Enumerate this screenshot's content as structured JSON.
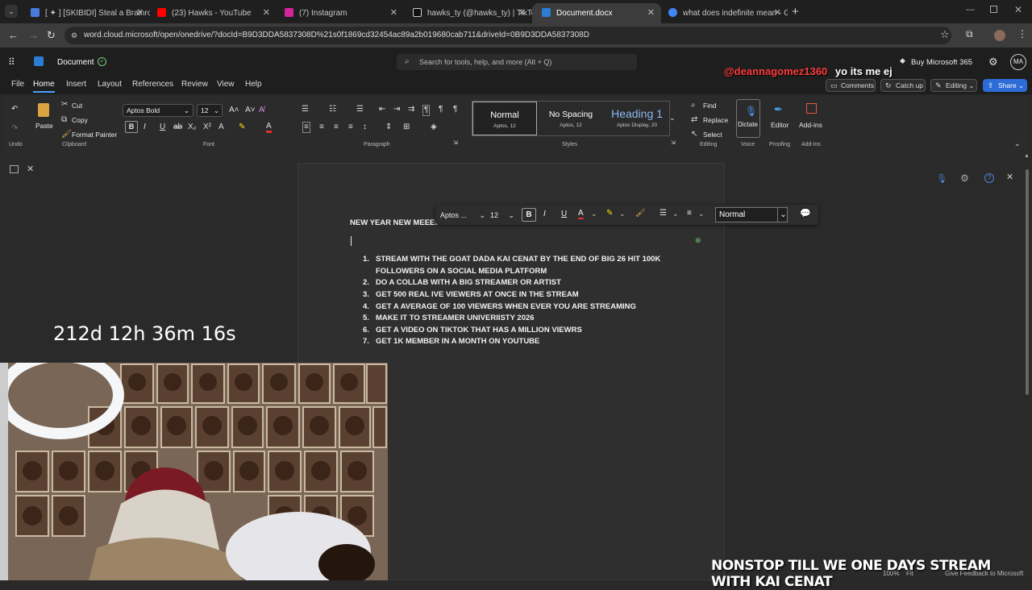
{
  "tabs": [
    {
      "title": "[ ✦ ] [SKIBIDI] Steal a Brainrot - ",
      "favicon_color": "#4a7bd8"
    },
    {
      "title": "(23) Hawks - YouTube",
      "favicon_color": "#ff0000"
    },
    {
      "title": "(7) Instagram",
      "favicon_color": "#d6249f"
    },
    {
      "title": "hawks_ty (@hawks_ty) | TikTok",
      "favicon_color": "#111111"
    },
    {
      "title": "Document.docx",
      "favicon_color": "#2b7cd3"
    },
    {
      "title": "what does indefinite mean - Go",
      "favicon_color": "#4285f4"
    }
  ],
  "url": "word.cloud.microsoft/open/onedrive/?docId=B9D3DDA5837308D%21s0f1869cd32454ac89a2b019680cab711&driveId=0B9D3DDA5837308D",
  "word": {
    "doc_title": "Document",
    "search_placeholder": "Search for tools, help, and more (Alt + Q)",
    "buy": "Buy Microsoft 365",
    "avatar": "MA",
    "menus": [
      "File",
      "Home",
      "Insert",
      "Layout",
      "References",
      "Review",
      "View",
      "Help"
    ],
    "actions": {
      "comments": "Comments",
      "catchup": "Catch up",
      "editing": "Editing",
      "share": "Share"
    }
  },
  "ribbon": {
    "undo": "Undo",
    "paste": "Paste",
    "cut": "Cut",
    "copy": "Copy",
    "format_painter": "Format Painter",
    "clipboard": "Clipboard",
    "font_name": "Aptos Bold",
    "font_size": "12",
    "font": "Font",
    "paragraph": "Paragraph",
    "styles": [
      {
        "name": "Normal",
        "sub": "Aptos, 12"
      },
      {
        "name": "No Spacing",
        "sub": "Aptos, 12"
      },
      {
        "name": "Heading 1",
        "sub": "Aptos Display, 20"
      }
    ],
    "styles_label": "Styles",
    "find": "Find",
    "replace": "Replace",
    "select": "Select",
    "editing_label": "Editing",
    "dictate": "Dictate",
    "voice": "Voice",
    "editor": "Editor",
    "proofing": "Proofing",
    "addins": "Add-ins",
    "addins_label": "Add-ins"
  },
  "floating_toolbar": {
    "font": "Aptos ...",
    "size": "12",
    "style": "Normal"
  },
  "document": {
    "heading": "NEW YEAR NEW MEEEEE!",
    "items": [
      [
        "STREAM WITH THE GOAT DADA KAI CENAT BY THE END OF BIG 26 HIT 100K",
        "FOLLOWERS ON A SOCIAL MEDIA PLATFORM"
      ],
      [
        "DO A COLLAB WITH A BIG STREAMER OR ARTIST"
      ],
      [
        "GET 500 REAL IVE VIEWERS AT ONCE IN THE STREAM"
      ],
      [
        "GET A AVERAGE OF 100 VIEWERS WHEN EVER YOU ARE STREAMING"
      ],
      [
        "MAKE IT TO STREAMER UNIVERIISTY 2026"
      ],
      [
        "GET A VIDEO ON TIKTOK THAT HAS A MILLION VIEWRS"
      ],
      [
        "GET 1K MEMBER IN A MONTH ON YOUTUBE"
      ]
    ],
    "numbers": [
      "1.",
      "2.",
      "3.",
      "4.",
      "5.",
      "6.",
      "7."
    ]
  },
  "overlay": {
    "timer": "212d 12h 36m 16s",
    "chat_user": "@deannagomez1360",
    "chat_msg": "yo its me ej",
    "banner": "NONSTOP TILL WE ONE DAYS STREAM WITH KAI CENAT",
    "status_zoom": "100%",
    "status_fit": "Fit",
    "status_feedback": "Give Feedback to Microsoft"
  },
  "colors": {
    "accent": "#4aa0ff",
    "chat_user": "#ff3c3c",
    "share": "#2b6cd6"
  }
}
